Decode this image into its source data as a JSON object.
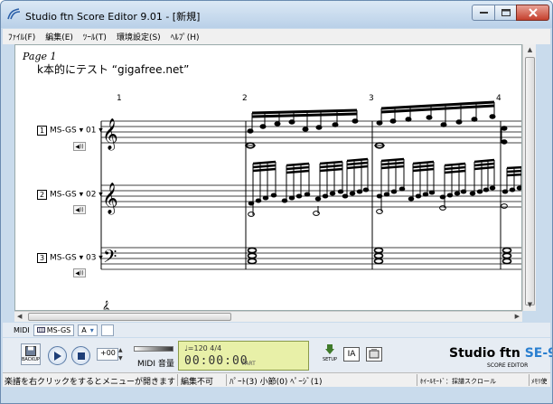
{
  "window": {
    "title": "Studio ftn Score Editor 9.01 - [新規]"
  },
  "menu": {
    "items": [
      "ﾌｧｲﾙ(F)",
      "編集(E)",
      "ﾂｰﾙ(T)",
      "環境設定(S)",
      "ﾍﾙﾌﾟ(H)"
    ]
  },
  "score": {
    "page_label": "Page 1",
    "title": "k本的にテスト “gigafree.net”",
    "measure_numbers": [
      "1",
      "2",
      "3",
      "4"
    ],
    "tracks": [
      {
        "num": "1",
        "name": "MS-GS ▾ 01 ▾",
        "clef": "treble"
      },
      {
        "num": "2",
        "name": "MS-GS ▾ 02 ▾",
        "clef": "treble"
      },
      {
        "num": "3",
        "name": "MS-GS ▾ 03 ▾",
        "clef": "bass"
      }
    ],
    "speaker_label": "◀))"
  },
  "midibar": {
    "label": "MIDI",
    "port": "MS-GS",
    "channel": "A"
  },
  "toolbar": {
    "save_label": "BACKUP",
    "transpose": "+00",
    "midi_volume_label": "MIDI 音量",
    "tempo": "♩=120   4/4",
    "time": "00:00:00",
    "part": "PART",
    "setup_label": "SETUP",
    "ia_label": "IA",
    "logo_main": "Studio ftn ",
    "logo_se": "SE-9",
    "logo_sub": "SCORE EDITOR"
  },
  "status": {
    "hint": "楽譜を右クリックをするとメニューが開きます",
    "edit_state": "編集不可",
    "position": "ﾊﾟｰﾄ(3) 小節(0) ﾍﾟｰｼﾞ(1)",
    "wheel_mode": "ﾎｲｰﾙﾓｰﾄﾞ：採譜スクロール",
    "memory": "ﾒﾓﾘ使"
  },
  "colors": {
    "titlebar": "#c9dbec",
    "lcd": "#e8f0a8",
    "logo_accent": "#2a7fd0",
    "close_button": "#c5402d"
  }
}
